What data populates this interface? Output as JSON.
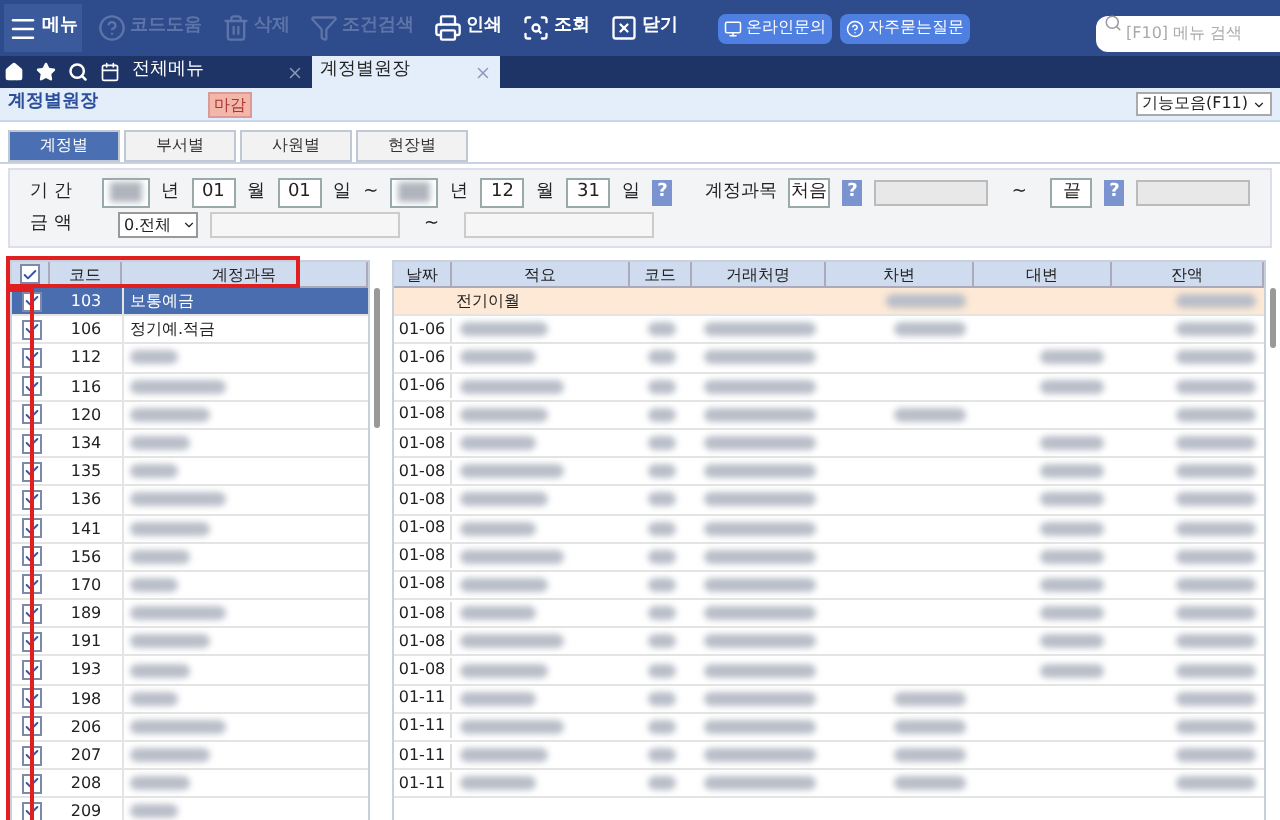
{
  "toolbar": [
    {
      "label": "메뉴",
      "disabled": false
    },
    {
      "label": "코드도움",
      "disabled": true
    },
    {
      "label": "삭제",
      "disabled": true
    },
    {
      "label": "조건검색",
      "disabled": true
    },
    {
      "label": "인쇄",
      "disabled": false
    },
    {
      "label": "조회",
      "disabled": false
    },
    {
      "label": "닫기",
      "disabled": false
    }
  ],
  "help_buttons": [
    {
      "label": "온라인문의"
    },
    {
      "label": "자주묻는질문"
    }
  ],
  "search": {
    "placeholder": "[F10] 메뉴 검색"
  },
  "doc_tabs": [
    {
      "label": "전체메뉴",
      "selected": false
    },
    {
      "label": "계정별원장",
      "selected": true
    }
  ],
  "page": {
    "title": "계정별원장",
    "badge": "마감",
    "functions": "기능모음(F11)"
  },
  "view_tabs": [
    {
      "label": "계정별",
      "selected": true
    },
    {
      "label": "부서별",
      "selected": false
    },
    {
      "label": "사원별",
      "selected": false
    },
    {
      "label": "현장별",
      "selected": false
    }
  ],
  "filter": {
    "period_label": "기 간",
    "from": {
      "year_unit": "년",
      "month": "01",
      "month_unit": "월",
      "day": "01",
      "day_unit": "일"
    },
    "tilde": "~",
    "to": {
      "year_unit": "년",
      "month": "12",
      "month_unit": "월",
      "day": "31",
      "day_unit": "일"
    },
    "help": "?",
    "account_label": "계정과목",
    "account_from": "처음",
    "account_to": "끝",
    "amount_label": "금 액",
    "amount_select": "0.전체"
  },
  "accounts": {
    "columns": [
      "코드",
      "계정과목"
    ],
    "all_checked": true,
    "rows": [
      {
        "code": "103",
        "name": "보통예금",
        "checked": true,
        "selected": true
      },
      {
        "code": "106",
        "name": "정기예.적금",
        "checked": true,
        "selected": false
      },
      {
        "code": "112",
        "checked": true,
        "selected": false
      },
      {
        "code": "116",
        "checked": true,
        "selected": false
      },
      {
        "code": "120",
        "checked": true,
        "selected": false
      },
      {
        "code": "134",
        "checked": true,
        "selected": false
      },
      {
        "code": "135",
        "checked": true,
        "selected": false
      },
      {
        "code": "136",
        "checked": true,
        "selected": false
      },
      {
        "code": "141",
        "checked": true,
        "selected": false
      },
      {
        "code": "156",
        "checked": true,
        "selected": false
      },
      {
        "code": "170",
        "checked": true,
        "selected": false
      },
      {
        "code": "189",
        "checked": true,
        "selected": false
      },
      {
        "code": "191",
        "checked": true,
        "selected": false
      },
      {
        "code": "193",
        "checked": true,
        "selected": false
      },
      {
        "code": "198",
        "checked": true,
        "selected": false
      },
      {
        "code": "206",
        "checked": true,
        "selected": false
      },
      {
        "code": "207",
        "checked": true,
        "selected": false
      },
      {
        "code": "208",
        "checked": true,
        "selected": false
      },
      {
        "code": "209",
        "checked": true,
        "selected": false
      }
    ]
  },
  "ledger": {
    "columns": [
      "날짜",
      "적요",
      "코드",
      "거래처명",
      "차변",
      "대변",
      "잔액"
    ],
    "carry_over": {
      "label": "전기이월"
    },
    "rows": [
      {
        "date": "01-06",
        "kind": "debit"
      },
      {
        "date": "01-06",
        "kind": "credit"
      },
      {
        "date": "01-06",
        "kind": "credit"
      },
      {
        "date": "01-08",
        "kind": "debit"
      },
      {
        "date": "01-08",
        "kind": "credit"
      },
      {
        "date": "01-08",
        "kind": "credit"
      },
      {
        "date": "01-08",
        "kind": "credit"
      },
      {
        "date": "01-08",
        "kind": "credit"
      },
      {
        "date": "01-08",
        "kind": "credit"
      },
      {
        "date": "01-08",
        "kind": "credit"
      },
      {
        "date": "01-08",
        "kind": "credit"
      },
      {
        "date": "01-08",
        "kind": "credit"
      },
      {
        "date": "01-08",
        "kind": "credit"
      },
      {
        "date": "01-11",
        "kind": "debit"
      },
      {
        "date": "01-11",
        "kind": "debit"
      },
      {
        "date": "01-11",
        "kind": "debit"
      },
      {
        "date": "01-11",
        "kind": "debit"
      }
    ]
  }
}
